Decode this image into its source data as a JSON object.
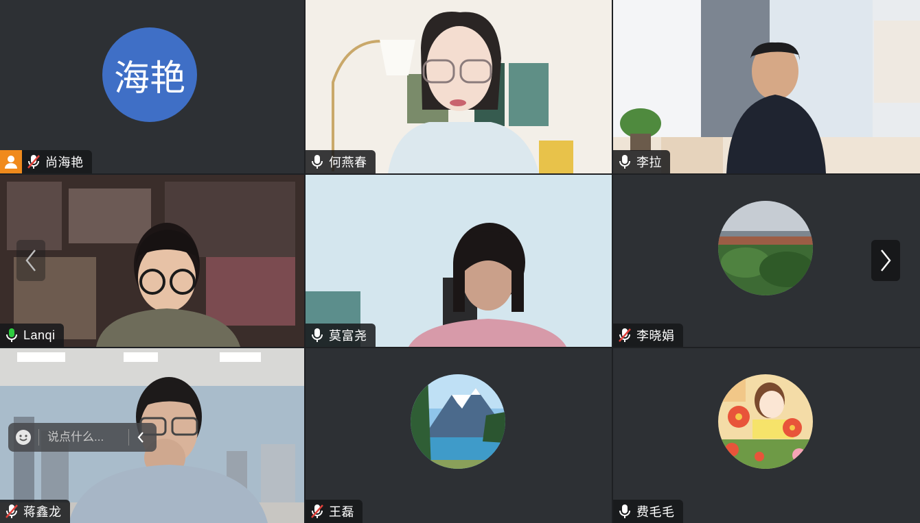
{
  "participants": [
    {
      "name": "尚海艳",
      "initials": "海艳",
      "mic": "muted",
      "host": true,
      "kind": "text-avatar"
    },
    {
      "name": "何燕春",
      "mic": "on",
      "kind": "video"
    },
    {
      "name": "李拉",
      "mic": "on",
      "kind": "video"
    },
    {
      "name": "Lanqi",
      "mic": "speaking",
      "kind": "video",
      "active": true
    },
    {
      "name": "莫富尧",
      "mic": "on",
      "kind": "video"
    },
    {
      "name": "李晓娟",
      "mic": "muted",
      "kind": "photo-avatar"
    },
    {
      "name": "蒋鑫龙",
      "mic": "muted",
      "kind": "video"
    },
    {
      "name": "王磊",
      "mic": "muted",
      "kind": "photo-avatar"
    },
    {
      "name": "费毛毛",
      "mic": "on",
      "kind": "photo-avatar"
    }
  ],
  "chat": {
    "placeholder": "说点什么..."
  },
  "colors": {
    "active_border": "#1db954",
    "host_badge": "#f08a1c",
    "text_avatar_bg": "#3f6fc6",
    "tile_bg": "#2d3034"
  },
  "icons": {
    "prev": "chevron-left-icon",
    "next": "chevron-right-icon",
    "emoji": "smiley-icon",
    "collapse": "chevron-left-icon"
  }
}
